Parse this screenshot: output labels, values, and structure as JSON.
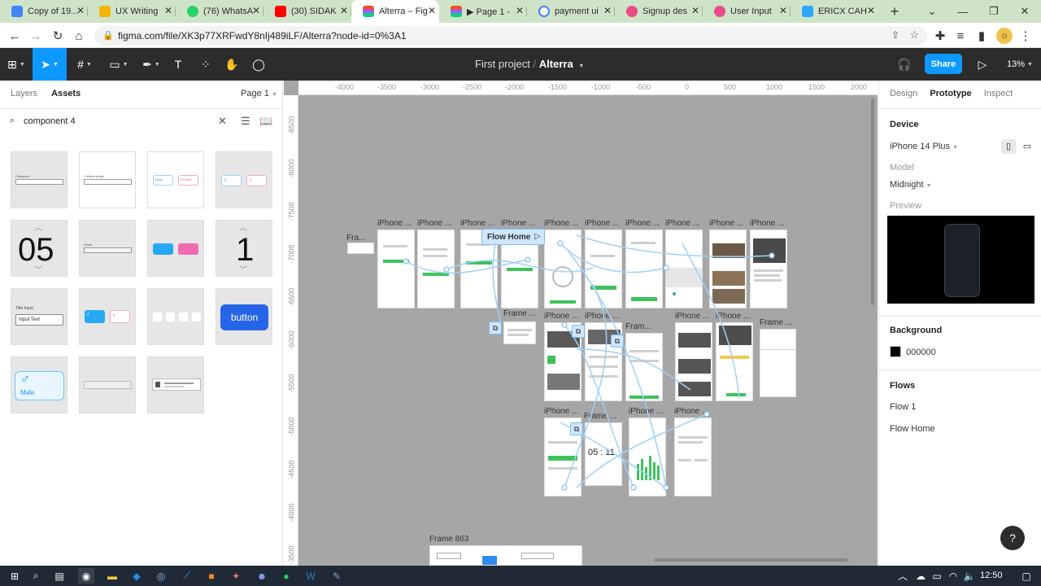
{
  "browser": {
    "tabs": [
      {
        "title": "Copy of 19...",
        "fav_color": "#4285f4",
        "active": false
      },
      {
        "title": "UX Writing",
        "fav_color": "#f4b400",
        "active": false
      },
      {
        "title": "(76) WhatsA",
        "fav_color": "#25d366",
        "active": false
      },
      {
        "title": "(30) SIDAK",
        "fav_color": "#ff0000",
        "active": false
      },
      {
        "title": "Alterra – Fig",
        "fav_color": "#a259ff",
        "active": true
      },
      {
        "title": "▶ Page 1 -",
        "fav_color": "#a259ff",
        "active": false
      },
      {
        "title": "payment ui",
        "fav_color": "#4285f4",
        "active": false
      },
      {
        "title": "Signup des",
        "fav_color": "#ea4c89",
        "active": false
      },
      {
        "title": "User Input",
        "fav_color": "#ea4c89",
        "active": false
      },
      {
        "title": "ERICX CAH",
        "fav_color": "#2da7ff",
        "active": false
      }
    ],
    "new_tab": "+",
    "url": "figma.com/file/XK3p77XRFwdY8nIj489iLF/Alterra?node-id=0%3A1"
  },
  "figma": {
    "project": "First project",
    "separator": "/",
    "file": "Alterra",
    "share": "Share",
    "zoom": "13%"
  },
  "left_panel": {
    "tabs": [
      "Layers",
      "Assets"
    ],
    "page": "Page 1",
    "search_query": "component 4",
    "asset_texts": {
      "password": "Password",
      "confirm": "Confirm email",
      "male": "Male",
      "female": "Female",
      "num05": "05",
      "num1": "1",
      "email": "Email",
      "title_input": "Title Input",
      "input_text": "Input Text",
      "button": "button",
      "male_big": "Male"
    }
  },
  "canvas": {
    "ruler_x": [
      "-4000",
      "-3500",
      "-3000",
      "-2500",
      "-2000",
      "-1500",
      "-1000",
      "-500",
      "0",
      "500",
      "1000",
      "1500",
      "2000"
    ],
    "ruler_y": [
      "-8500",
      "-8000",
      "-7500",
      "-7000",
      "-6500",
      "-6000",
      "-5500",
      "-5000",
      "-4500",
      "-4000",
      "-3500"
    ],
    "flow_label": "Flow Home",
    "frame_small": "Fra...",
    "phone_label": "iPhone ...",
    "frame_label": "Frame ...",
    "frame863": "Frame 863",
    "timer": "05 : 11",
    "frame_title_b": "Fram..."
  },
  "right_panel": {
    "tabs": [
      "Design",
      "Prototype",
      "Inspect"
    ],
    "device_header": "Device",
    "device": "iPhone 14 Plus",
    "model_label": "Model",
    "model": "Midnight",
    "preview_label": "Preview",
    "background_header": "Background",
    "background_hex": "000000",
    "background_color": "#000000",
    "flows_header": "Flows",
    "flows": [
      "Flow 1",
      "Flow Home"
    ]
  },
  "help": "?",
  "taskbar": {
    "time": "12:50"
  }
}
